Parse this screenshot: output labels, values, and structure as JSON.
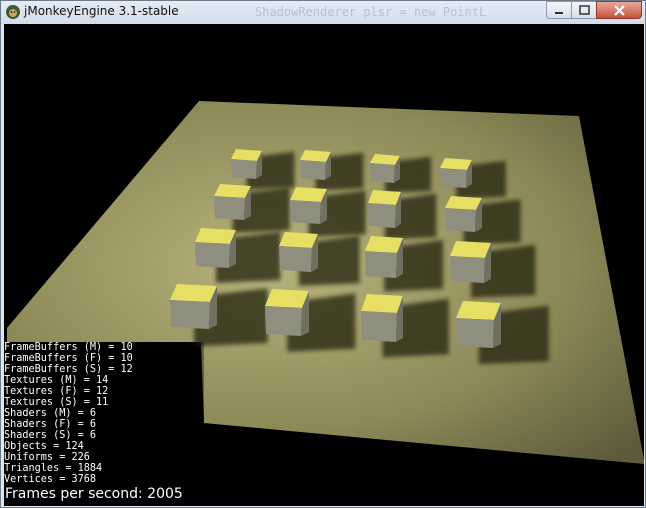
{
  "window": {
    "title": "jMonkeyEngine 3.1-stable",
    "behind_title_ghost": "ShadowRenderer plsr = new PointL"
  },
  "scene": {
    "cube_top_color": "#e6df63",
    "cube_side_color": "#8f8f80",
    "floor_color": "#908c5a",
    "background_color": "#000000"
  },
  "stats": [
    "FrameBuffers (M) = 10",
    "FrameBuffers (F) = 10",
    "FrameBuffers (S) = 12",
    "Textures (M) = 14",
    "Textures (F) = 12",
    "Textures (S) = 11",
    "Shaders (M) = 6",
    "Shaders (F) = 6",
    "Shaders (S) = 6",
    "Objects = 124",
    "Uniforms = 226",
    "Triangles = 1884",
    "Vertices = 3768"
  ],
  "fps_text": "Frames per second: 2005"
}
